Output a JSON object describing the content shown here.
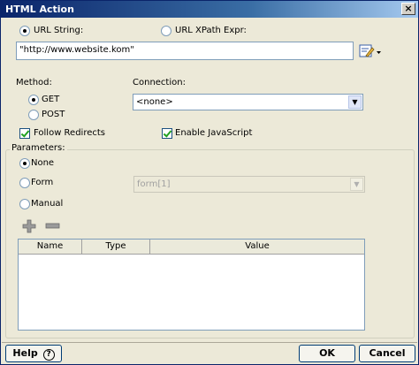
{
  "window": {
    "title": "HTML Action",
    "close_glyph": "×"
  },
  "url": {
    "string_label": "URL String:",
    "xpath_label": "URL XPath Expr:",
    "value": "\"http://www.website.kom\"",
    "selected": "url_string"
  },
  "method": {
    "label": "Method:",
    "options": [
      "GET",
      "POST"
    ],
    "selected": "GET"
  },
  "connection": {
    "label": "Connection:",
    "value": "<none>"
  },
  "options": {
    "follow_redirects": {
      "label": "Follow Redirects",
      "checked": true
    },
    "enable_javascript": {
      "label": "Enable JavaScript",
      "checked": true
    }
  },
  "parameters": {
    "label": "Parameters:",
    "options": [
      "None",
      "Form",
      "Manual"
    ],
    "selected": "None",
    "form_value": "form[1]",
    "table_headers": [
      "Name",
      "Type",
      "Value"
    ],
    "rows": []
  },
  "footer": {
    "help_label": "Help",
    "help_icon": "?",
    "ok_label": "OK",
    "cancel_label": "Cancel"
  },
  "icons": {
    "edit": "edit-expression-icon",
    "add": "add-parameter-icon",
    "remove": "remove-parameter-icon"
  }
}
